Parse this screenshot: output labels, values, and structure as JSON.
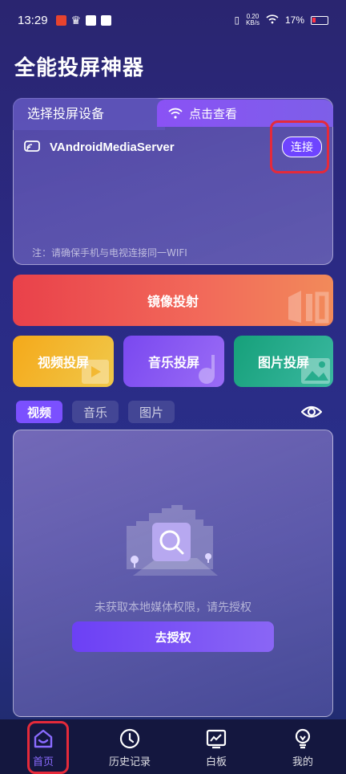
{
  "status_bar": {
    "time": "13:29",
    "net_speed_value": "0.20",
    "net_speed_unit": "KB/s",
    "battery": "17%"
  },
  "app": {
    "title": "全能投屏神器"
  },
  "device_card": {
    "tab_select_label": "选择投屏设备",
    "tab_view_label": "点击查看",
    "device_name": "VAndroidMediaServer",
    "connect_label": "连接",
    "note": "注：请确保手机与电视连接同一WIFI"
  },
  "actions": {
    "mirror_label": "镜像投射",
    "video_cast_label": "视频投屏",
    "music_cast_label": "音乐投屏",
    "picture_cast_label": "图片投屏"
  },
  "media_tabs": [
    {
      "label": "视频",
      "active": true
    },
    {
      "label": "音乐",
      "active": false
    },
    {
      "label": "图片",
      "active": false
    }
  ],
  "empty_state": {
    "message": "未获取本地媒体权限，请先授权",
    "button_label": "去授权"
  },
  "bottom_nav": [
    {
      "label": "首页",
      "icon": "home-icon",
      "active": true
    },
    {
      "label": "历史记录",
      "icon": "clock-icon",
      "active": false
    },
    {
      "label": "白板",
      "icon": "whiteboard-icon",
      "active": false
    },
    {
      "label": "我的",
      "icon": "profile-icon",
      "active": false
    }
  ],
  "colors": {
    "accent": "#7b50ff",
    "highlight": "#e52a3a",
    "mirror": "#e9414a",
    "video": "#f5a91a",
    "music": "#7a48f0",
    "picture": "#16a07a"
  }
}
